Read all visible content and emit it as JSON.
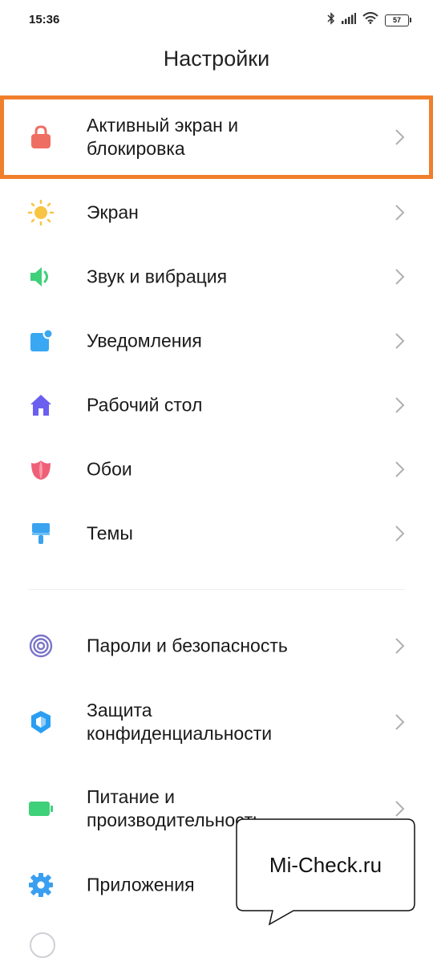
{
  "status_bar": {
    "time": "15:36",
    "battery": "57",
    "icons": [
      "bluetooth-icon",
      "signal-icon",
      "wifi-icon",
      "battery-icon"
    ]
  },
  "page": {
    "title": "Настройки"
  },
  "settings_items": [
    {
      "label": "Активный экран и\nблокировка",
      "icon": "lock-icon",
      "highlighted": true
    },
    {
      "label": "Экран",
      "icon": "sun-icon"
    },
    {
      "label": "Звук и вибрация",
      "icon": "speaker-icon"
    },
    {
      "label": "Уведомления",
      "icon": "notification-icon"
    },
    {
      "label": "Рабочий стол",
      "icon": "home-icon"
    },
    {
      "label": "Обои",
      "icon": "tulip-icon"
    },
    {
      "label": "Темы",
      "icon": "brush-icon"
    },
    {
      "label": "Пароли и безопасность",
      "icon": "fingerprint-icon"
    },
    {
      "label": "Защита\nконфиденциальности",
      "icon": "shield-icon"
    },
    {
      "label": "Питание и\nпроизводительность",
      "icon": "battery-power-icon"
    },
    {
      "label": "Приложения",
      "icon": "gear-icon"
    }
  ],
  "watermark": {
    "text": "Mi-Check.ru"
  },
  "colors": {
    "highlight": "#f07f2c",
    "lock": "#ef6e63",
    "sun": "#f8c443",
    "sound": "#3fd07a",
    "notify": "#3aa7f2",
    "home": "#6b5ff0",
    "wallpaper": "#f05f78",
    "theme": "#3aa3f0",
    "security": "#7a74c9",
    "privacy": "#2a9ef2",
    "power": "#3fd07a",
    "apps": "#3a9ff0"
  }
}
